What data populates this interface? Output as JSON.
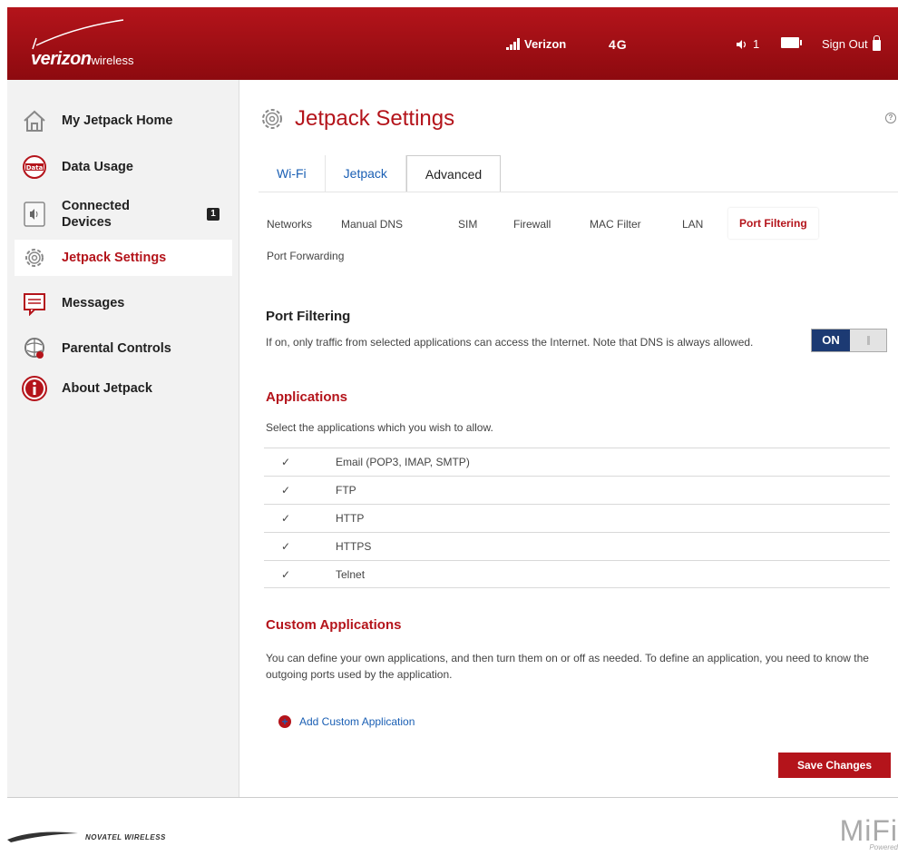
{
  "header": {
    "logo_main": "verizon",
    "logo_sub": "wireless",
    "carrier": "Verizon",
    "network": "4G",
    "connected_count": "1",
    "sign_out": "Sign Out"
  },
  "sidebar": {
    "items": [
      {
        "label": "My Jetpack Home",
        "icon": "home-icon"
      },
      {
        "label": "Data Usage",
        "icon": "data-icon"
      },
      {
        "label": "Connected Devices",
        "icon": "devices-icon",
        "badge": "1"
      },
      {
        "label": "Jetpack Settings",
        "icon": "gear-icon",
        "active": true
      },
      {
        "label": "Messages",
        "icon": "messages-icon"
      },
      {
        "label": "Parental Controls",
        "icon": "parental-icon"
      },
      {
        "label": "About Jetpack",
        "icon": "info-icon"
      }
    ]
  },
  "main": {
    "title": "Jetpack Settings",
    "tabs": [
      "Wi-Fi",
      "Jetpack",
      "Advanced"
    ],
    "active_tab": "Advanced",
    "subtabs": [
      "Networks",
      "Manual DNS",
      "SIM",
      "Firewall",
      "MAC Filter",
      "LAN",
      "Port Filtering",
      "Port Forwarding"
    ],
    "active_subtab": "Port Filtering",
    "port_filtering": {
      "title": "Port Filtering",
      "description": "If on, only traffic from selected applications can access the Internet. Note that DNS is always allowed.",
      "toggle_label": "ON"
    },
    "applications": {
      "title": "Applications",
      "description": "Select the applications which you wish to allow.",
      "items": [
        {
          "name": "Email (POP3, IMAP, SMTP)",
          "checked": true
        },
        {
          "name": "FTP",
          "checked": true
        },
        {
          "name": "HTTP",
          "checked": true
        },
        {
          "name": "HTTPS",
          "checked": true
        },
        {
          "name": "Telnet",
          "checked": true
        }
      ]
    },
    "custom_applications": {
      "title": "Custom Applications",
      "description": "You can define your own applications, and then turn them on or off as needed. To define an application, you need to know the outgoing ports used by the application.",
      "add_link": "Add Custom Application"
    },
    "save_button": "Save Changes"
  },
  "footer": {
    "novatel": "NOVATEL WIRELESS",
    "mifi": "MiFi",
    "mifi_sub": "Powered"
  },
  "colors": {
    "brand_red": "#b4141b",
    "toggle_blue": "#1c3a73",
    "link_blue": "#1a5fb4"
  }
}
